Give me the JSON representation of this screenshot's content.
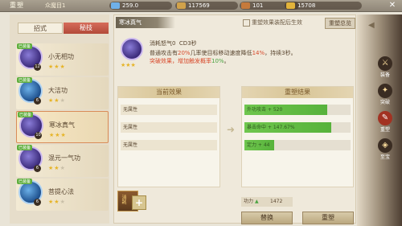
{
  "topbar": {
    "title": "重塑",
    "subtitle": "众魔目1",
    "resources": [
      {
        "name": "gem",
        "value": "259.0",
        "color": "#6fb0e8"
      },
      {
        "name": "copper",
        "value": "117569",
        "color": "#d1a24a"
      },
      {
        "name": "token",
        "value": "101",
        "color": "#c67a3c"
      },
      {
        "name": "gold",
        "value": "15708",
        "color": "#e2b33a"
      }
    ]
  },
  "tabs": {
    "t1": "招式",
    "t2": "秘技"
  },
  "skills": [
    {
      "name": "小无相功",
      "level": "12",
      "stars": 3,
      "max_stars": 3,
      "badge": "已装备",
      "tone": "purple"
    },
    {
      "name": "大洁功",
      "level": "6",
      "stars": 2,
      "max_stars": 3,
      "badge": "已装备",
      "tone": "blue"
    },
    {
      "name": "寒冰真气",
      "level": "10",
      "stars": 3,
      "max_stars": 3,
      "badge": "已装备",
      "tone": "purple"
    },
    {
      "name": "混元一气功",
      "level": "6",
      "stars": 2,
      "max_stars": 3,
      "badge": "已装备",
      "tone": "purple"
    },
    {
      "name": "菩提心法",
      "level": "6",
      "stars": 2,
      "max_stars": 3,
      "badge": "已装备",
      "tone": "blue"
    }
  ],
  "detail": {
    "name": "寒冰真气",
    "note": "重塑效果装配后生效",
    "overview_btn": "重塑总览",
    "cost": "消耗怒气0",
    "cd": "CD3秒",
    "desc_a": "普通攻击有",
    "desc_pct1": "20%",
    "desc_b": "几率使目标移动速度降低",
    "desc_pct2": "14%",
    "desc_c": "，持续3秒。",
    "desc_d": "突破效果，增加触发概率",
    "desc_pct3": "10%",
    "desc_e": "。",
    "stars": 3
  },
  "current": {
    "header": "当前效果",
    "rows": [
      "无属性",
      "无属性",
      "无属性"
    ]
  },
  "result": {
    "header": "重塑结果",
    "rows": [
      {
        "text": "外功攻击 + 520",
        "fill": 0.78
      },
      {
        "text": "暴击命中 + 147.67%",
        "fill": 0.82
      },
      {
        "text": "定力 + 44",
        "fill": 0.28
      }
    ]
  },
  "material": {
    "label": "消耗"
  },
  "power": {
    "label": "功力",
    "value": "1472"
  },
  "buttons": {
    "swap": "替换",
    "reforge": "重塑"
  },
  "side_menu": [
    {
      "label": "装备",
      "glyph": "⚔"
    },
    {
      "label": "突破",
      "glyph": "✦"
    },
    {
      "label": "重塑",
      "glyph": "✎",
      "active": true
    },
    {
      "label": "至宝",
      "glyph": "◈"
    }
  ]
}
